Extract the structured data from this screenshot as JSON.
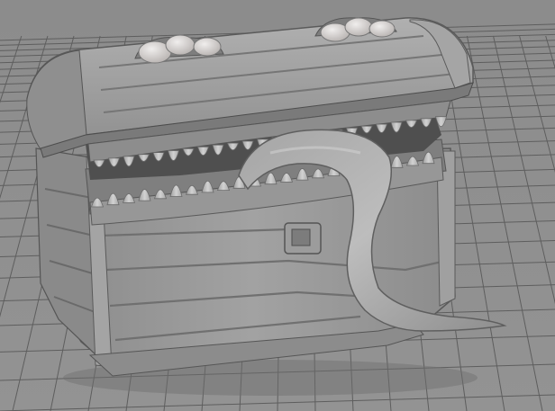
{
  "scene": {
    "subject_icon": "mimic-chest-icon",
    "background_color": "#8f8f8f",
    "grid_color": "#5a5a5a",
    "model_base_color": "#9a9a9a",
    "model_shadow_color": "#5c5c5c",
    "tooth_color": "#c9c9c9",
    "eye_color": "#d8d4d2"
  }
}
